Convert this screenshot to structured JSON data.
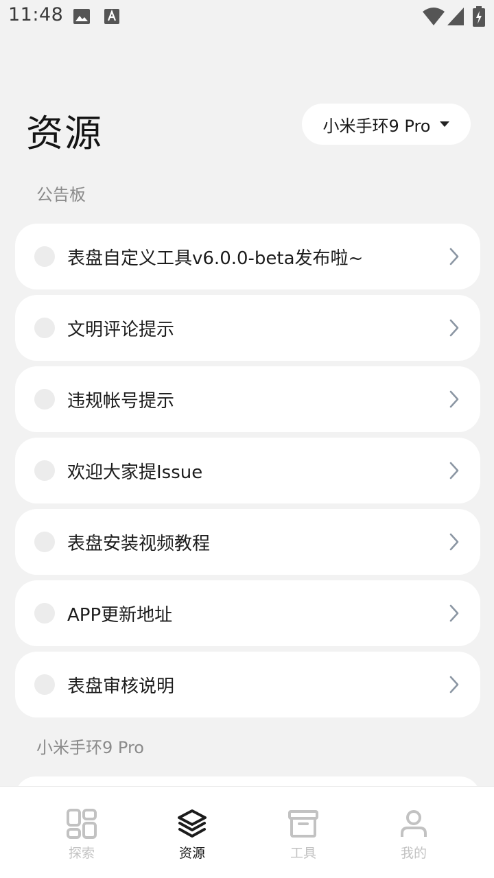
{
  "status_bar": {
    "time": "11:48",
    "icons": [
      "image-icon",
      "a-icon",
      "wifi-icon",
      "signal-icon",
      "battery-icon"
    ]
  },
  "header": {
    "title": "资源",
    "device_selector": "小米手环9 Pro",
    "device_selector_icon": "caret-down-icon"
  },
  "notice_board": {
    "label": "公告板",
    "items": [
      {
        "text": "表盘自定义工具v6.0.0-beta发布啦~"
      },
      {
        "text": "文明评论提示"
      },
      {
        "text": "违规帐号提示"
      },
      {
        "text": "欢迎大家提Issue"
      },
      {
        "text": "表盘安装视频教程"
      },
      {
        "text": "APP更新地址"
      },
      {
        "text": "表盘审核说明"
      }
    ]
  },
  "device_section": {
    "label": "小米手环9 Pro"
  },
  "bottom_nav": {
    "items": [
      {
        "label": "探索",
        "icon": "grid-icon",
        "active": false
      },
      {
        "label": "资源",
        "icon": "layers-icon",
        "active": true
      },
      {
        "label": "工具",
        "icon": "archive-box-icon",
        "active": false
      },
      {
        "label": "我的",
        "icon": "user-icon",
        "active": false
      }
    ]
  },
  "colors": {
    "background": "#f2f2f2",
    "card": "#ffffff",
    "active": "#1c1c1c",
    "inactive": "#c2c2c2",
    "chevron": "#8b96a3"
  }
}
